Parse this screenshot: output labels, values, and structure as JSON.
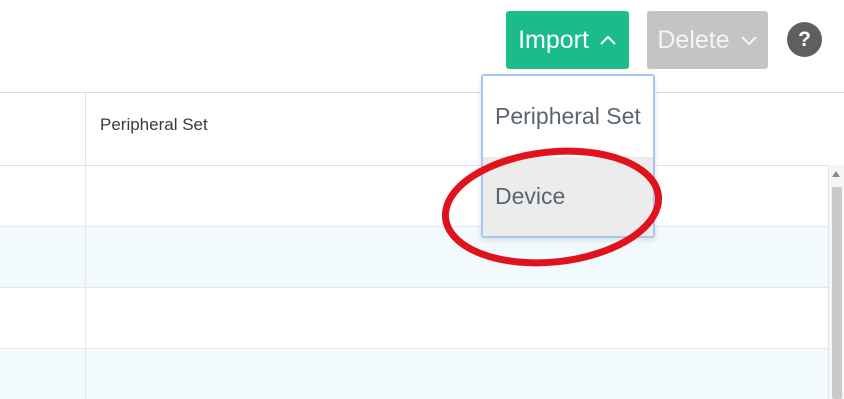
{
  "toolbar": {
    "import_label": "Import",
    "delete_label": "Delete",
    "help_label": "?"
  },
  "table": {
    "columns": [
      "",
      "Peripheral Set"
    ],
    "rows": [
      {
        "cells": [
          "",
          ""
        ]
      },
      {
        "cells": [
          "",
          ""
        ]
      },
      {
        "cells": [
          "",
          ""
        ]
      },
      {
        "cells": [
          "",
          ""
        ]
      }
    ]
  },
  "import_menu": {
    "items": [
      {
        "label": "Peripheral Set"
      },
      {
        "label": "Device"
      }
    ]
  },
  "colors": {
    "import_button": "#1bbc8b",
    "delete_button": "#c4c4c4",
    "help_icon": "#5f5f5f",
    "highlight_ring": "#e0131c",
    "dropdown_border": "#a9c6f2",
    "row_alt": "#f2fafd"
  },
  "icons": {
    "import_caret": "chevron-up-icon",
    "delete_caret": "chevron-down-icon",
    "help": "question-circle-icon"
  }
}
